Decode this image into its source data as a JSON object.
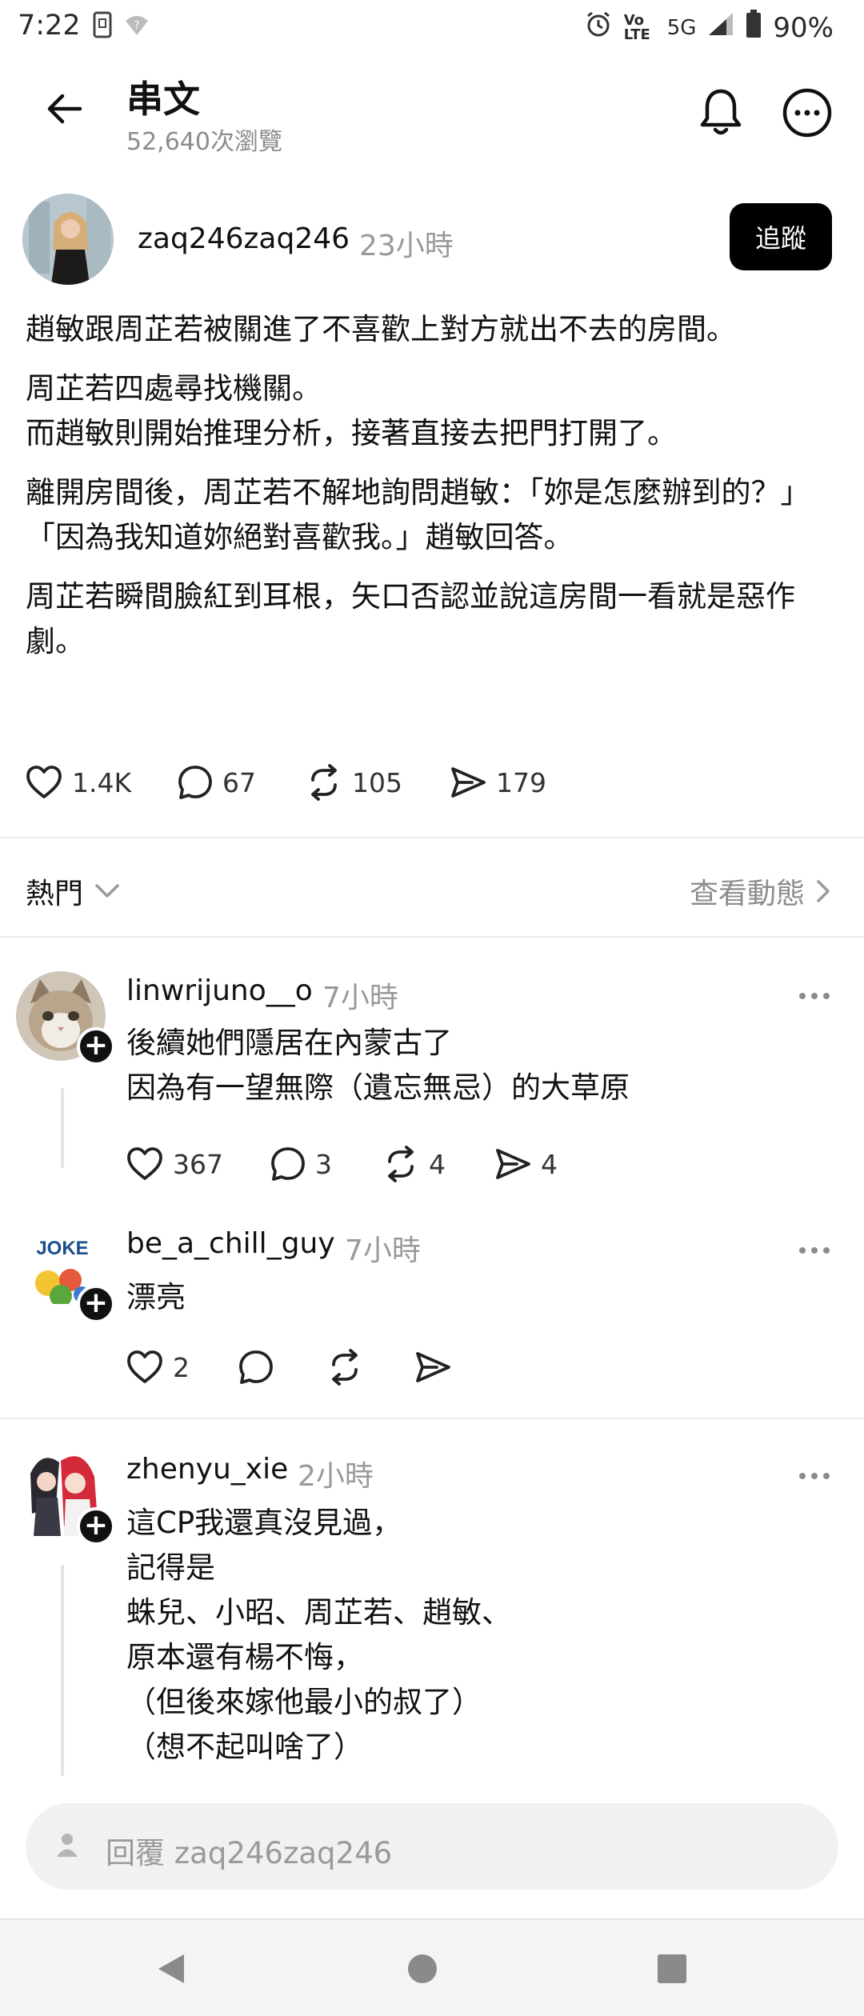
{
  "status_bar": {
    "time": "7:22",
    "network": "5G",
    "battery": "90%",
    "volte": "Vo LTE"
  },
  "header": {
    "title": "串文",
    "views": "52,640次瀏覽"
  },
  "post": {
    "author": "zaq246zaq246",
    "time": "23小時",
    "follow_label": "追蹤",
    "paragraphs": [
      "趙敏跟周芷若被關進了不喜歡上對方就出不去的房間。",
      "周芷若四處尋找機關。\n而趙敏則開始推理分析，接著直接去把門打開了。",
      "離開房間後，周芷若不解地詢問趙敏：「妳是怎麼辦到的？」\n「因為我知道妳絕對喜歡我。」趙敏回答。",
      "周芷若瞬間臉紅到耳根，矢口否認並說這房間一看就是惡作劇。"
    ],
    "likes": "1.4K",
    "comments": "67",
    "reposts": "105",
    "shares": "179"
  },
  "sort": {
    "label": "熱門",
    "activity_link": "查看動態"
  },
  "comments": [
    {
      "author": "linwrijuno__o",
      "time": "7小時",
      "text": "後續她們隱居在內蒙古了\n因為有一望無際（遺忘無忌）的大草原",
      "likes": "367",
      "replies": "3",
      "reposts": "4",
      "shares": "4"
    },
    {
      "author": "be_a_chill_guy",
      "time": "7小時",
      "text": "漂亮",
      "likes": "2",
      "avatar_text": "JOKE"
    },
    {
      "author": "zhenyu_xie",
      "time": "2小時",
      "text": "這CP我還真沒見過，\n記得是\n蛛兒、小昭、周芷若、趙敏、\n原本還有楊不悔，\n（但後來嫁他最小的叔了）\n（想不起叫啥了）"
    }
  ],
  "reply_bar": {
    "placeholder": "回覆 zaq246zaq246"
  },
  "colors": {
    "text": "#111111",
    "muted": "#999999",
    "follow_bg": "#000000",
    "reply_bg": "#f1f1f1"
  }
}
